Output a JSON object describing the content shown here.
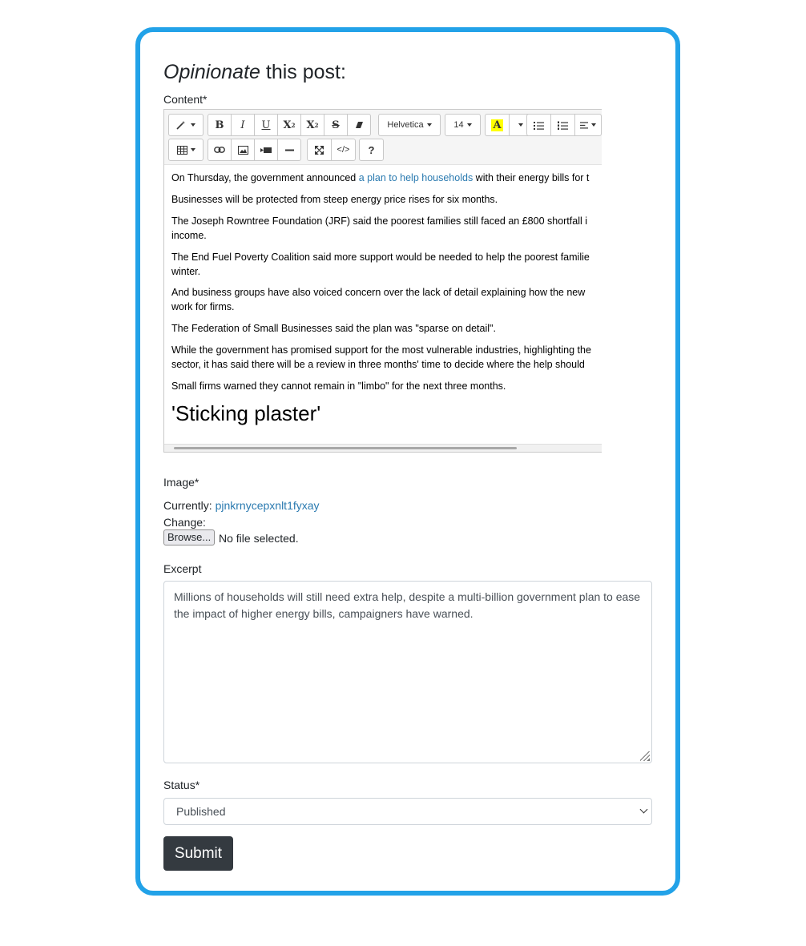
{
  "form": {
    "title_em": "Opinionate",
    "title_rest": " this post:",
    "content_label": "Content*",
    "image_label": "Image*",
    "currently_label": "Currently: ",
    "currently_value": "pjnkrnycepxnlt1fyxay",
    "change_label": "Change:",
    "browse_label": "Browse...",
    "no_file_text": "No file selected.",
    "excerpt_label": "Excerpt",
    "excerpt_value": "Millions of households will still need extra help, despite a multi-billion government plan to ease the impact of higher energy bills, campaigners have warned.",
    "status_label": "Status*",
    "status_selected": "Published",
    "submit_label": "Submit"
  },
  "toolbar": {
    "font_name": "Helvetica",
    "font_size": "14",
    "help": "?"
  },
  "editor": {
    "p1_a": "On Thursday, the government announced ",
    "p1_link": "a plan to help households",
    "p1_b": " with their energy bills for t",
    "p2": "Businesses will be protected from steep energy price rises for six months.",
    "p3_l1": "The Joseph Rowntree Foundation (JRF) said the poorest families still faced an £800 shortfall i",
    "p3_l2": "income.",
    "p4_l1": "The End Fuel Poverty Coalition said more support would be needed to help the poorest familie",
    "p4_l2": "winter.",
    "p5_l1": "And business groups have also voiced concern over the lack of detail explaining how the new",
    "p5_l2": "work for firms.",
    "p6": "The Federation of Small Businesses said the plan was \"sparse on detail\".",
    "p7_l1": "While the government has promised support for the most vulnerable industries, highlighting the",
    "p7_l2": "sector, it has said there will be a review in three months' time to decide where the help should",
    "p8": "Small firms warned they cannot remain in \"limbo\" for the next three months.",
    "h2": "'Sticking plaster'"
  }
}
